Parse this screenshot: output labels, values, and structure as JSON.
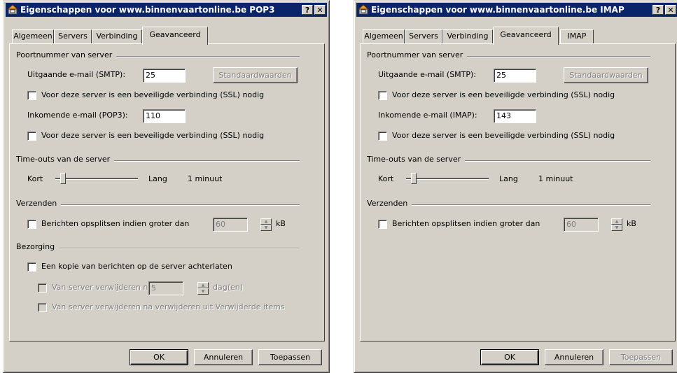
{
  "dialogs": [
    {
      "title": "Eigenschappen voor www.binnenvaartonline.be POP3",
      "tabs": [
        "Algemeen",
        "Servers",
        "Verbinding",
        "Geavanceerd"
      ],
      "active_tab": "Geavanceerd",
      "port_group_label": "Poortnummer van server",
      "smtp_label": "Uitgaande e-mail (SMTP):",
      "smtp_value": "25",
      "defaults_button": "Standaardwaarden",
      "ssl_smtp_label": "Voor deze server is een beveiligde verbinding (SSL) nodig",
      "incoming_label": "Inkomende e-mail (POP3):",
      "incoming_value": "110",
      "ssl_incoming_label": "Voor deze server is een beveiligde verbinding (SSL) nodig",
      "timeout_group_label": "Time-outs van de server",
      "timeout_short": "Kort",
      "timeout_long": "Lang",
      "timeout_value": "1 minuut",
      "timeout_level": 0.1,
      "send_group_label": "Verzenden",
      "split_label": "Berichten opsplitsen indien groter dan",
      "split_value": "60",
      "split_unit": "kB",
      "delivery_group_label": "Bezorging",
      "keep_copy_label": "Een kopie van berichten op de server achterlaten",
      "remove_after_label": "Van server verwijderen na",
      "remove_after_value": "5",
      "remove_after_unit": "dag(en)",
      "remove_deleted_label": "Van server verwijderen na verwijderen uit Verwijderde items",
      "ok_button": "OK",
      "cancel_button": "Annuleren",
      "apply_button": "Toepassen"
    },
    {
      "title": "Eigenschappen voor www.binnenvaartonline.be IMAP",
      "tabs": [
        "Algemeen",
        "Servers",
        "Verbinding",
        "Geavanceerd",
        "IMAP"
      ],
      "active_tab": "Geavanceerd",
      "port_group_label": "Poortnummer van server",
      "smtp_label": "Uitgaande e-mail (SMTP):",
      "smtp_value": "25",
      "defaults_button": "Standaardwaarden",
      "ssl_smtp_label": "Voor deze server is een beveiligde verbinding (SSL) nodig",
      "incoming_label": "Inkomende e-mail (IMAP):",
      "incoming_value": "143",
      "ssl_incoming_label": "Voor deze server is een beveiligde verbinding (SSL) nodig",
      "timeout_group_label": "Time-outs van de server",
      "timeout_short": "Kort",
      "timeout_long": "Lang",
      "timeout_value": "1 minuut",
      "timeout_level": 0.1,
      "send_group_label": "Verzenden",
      "split_label": "Berichten opsplitsen indien groter dan",
      "split_value": "60",
      "split_unit": "kB",
      "ok_button": "OK",
      "cancel_button": "Annuleren",
      "apply_button": "Toepassen"
    }
  ],
  "colors": {
    "titlebar": "#0a246a",
    "face": "#d4d0c8"
  },
  "icons": [
    "mail-server-icon",
    "help-icon",
    "close-icon"
  ]
}
